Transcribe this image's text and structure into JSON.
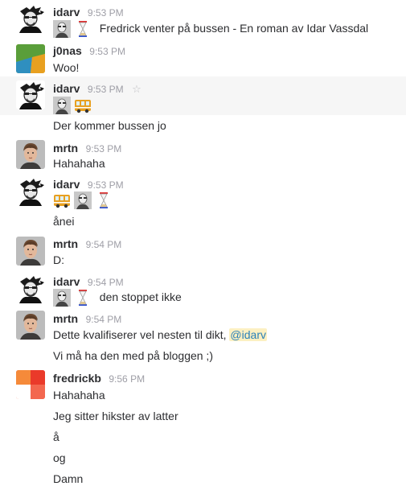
{
  "messages": [
    {
      "user": "idarv",
      "time": "9:53 PM",
      "lines": [
        "Fredrick venter på bussen - En roman av Idar Vassdal"
      ]
    },
    {
      "user": "j0nas",
      "time": "9:53 PM",
      "lines": [
        "Woo!"
      ]
    },
    {
      "user": "idarv",
      "time": "9:53 PM",
      "lines": [
        "Der kommer bussen jo"
      ]
    },
    {
      "user": "mrtn",
      "time": "9:53 PM",
      "lines": [
        "Hahahaha"
      ]
    },
    {
      "user": "idarv",
      "time": "9:53 PM",
      "lines": [
        "ånei"
      ]
    },
    {
      "user": "mrtn",
      "time": "9:54 PM",
      "lines": [
        "D:"
      ]
    },
    {
      "user": "idarv",
      "time": "9:54 PM",
      "lines": [
        "den stoppet ikke"
      ]
    },
    {
      "user": "mrtn",
      "time": "9:54 PM",
      "lines": [
        "Dette kvalifiserer vel nesten til dikt,",
        "Vi må ha den med på bloggen ;)"
      ],
      "mention": "@idarv"
    },
    {
      "user": "fredrickb",
      "time": "9:56 PM",
      "lines": [
        "Hahahaha",
        "Jeg sitter hikster av latter",
        "å",
        "og",
        "Damn"
      ]
    }
  ],
  "icons": [
    "person-emoji-icon",
    "hourglass-emoji-icon",
    "bus-emoji-icon",
    "star-icon"
  ],
  "colors": {
    "mention_bg": "#fcf0c2",
    "mention_text": "#2a80b9",
    "highlight_bg": "#f6f6f6",
    "timestamp": "#9e9ea6"
  }
}
